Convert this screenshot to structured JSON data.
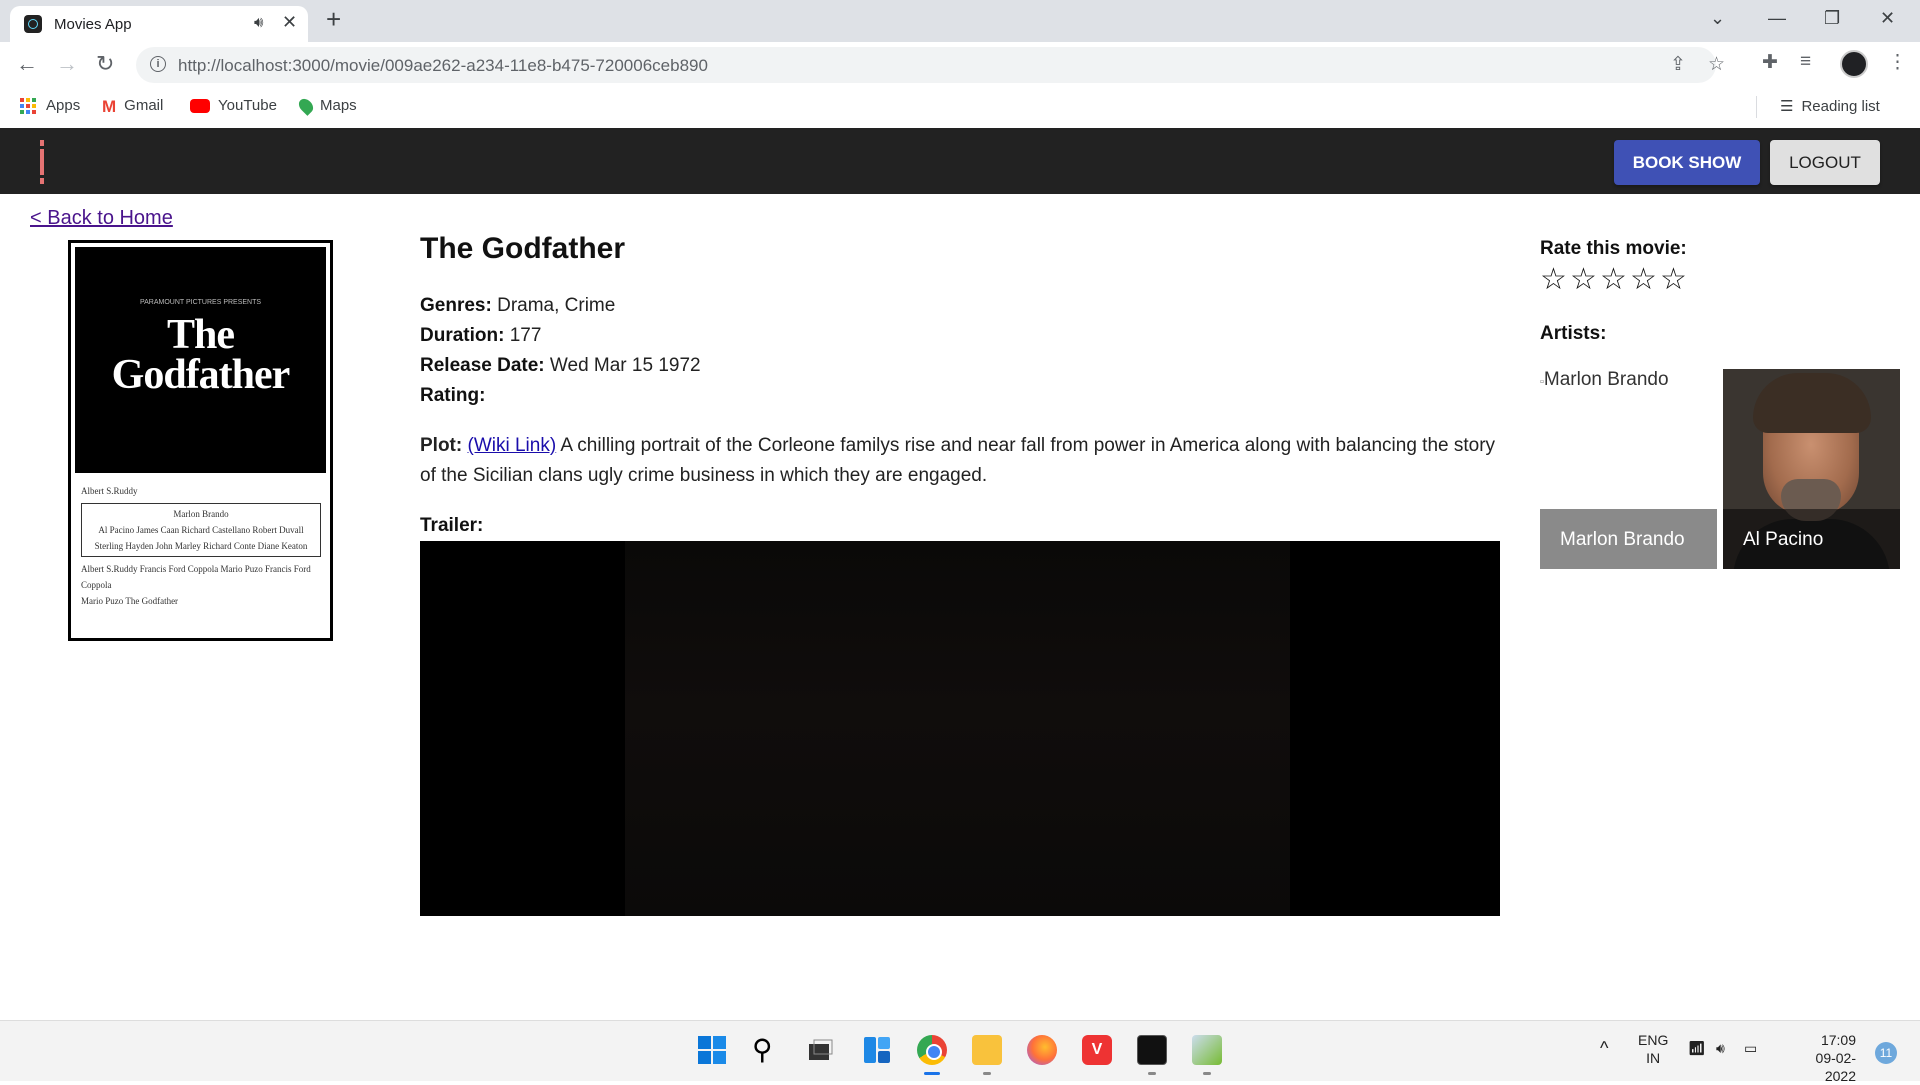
{
  "browser": {
    "tab_title": "Movies App",
    "url": "http://localhost:3000/movie/009ae262-a234-11e8-b475-720006ceb890",
    "bookmarks": [
      "Apps",
      "Gmail",
      "YouTube",
      "Maps"
    ],
    "reading_list": "Reading list"
  },
  "header": {
    "book_show": "BOOK SHOW",
    "logout": "LOGOUT"
  },
  "page": {
    "back_link": "< Back to Home",
    "poster": {
      "studio": "PARAMOUNT PICTURES PRESENTS",
      "title_line1": "The",
      "title_line2": "Godfather",
      "producer": "Albert S.Ruddy",
      "star": "Marlon Brando",
      "cast_row1": "Al Pacino   James Caan   Richard Castellano   Robert Duvall",
      "cast_row2": "Sterling Hayden   John Marley   Richard Conte   Diane Keaton",
      "credits_row1": "Albert S.Ruddy  Francis Ford Coppola  Mario Puzo  Francis Ford Coppola",
      "credits_row2": "Mario Puzo  The Godfather"
    },
    "title": "The Godfather",
    "genres_label": "Genres:",
    "genres": "Drama, Crime",
    "duration_label": "Duration:",
    "duration": "177",
    "release_label": "Release Date:",
    "release_date": "Wed Mar 15 1972",
    "rating_label": "Rating:",
    "plot_label": "Plot:",
    "wiki_link": "(Wiki Link)",
    "plot": "A chilling portrait of the Corleone familys rise and near fall from power in America along with balancing the story of the Sicilian clans ugly crime business in which they are engaged.",
    "trailer_label": "Trailer:"
  },
  "sidebar": {
    "rate_label": "Rate this movie:",
    "stars": [
      "☆",
      "☆",
      "☆",
      "☆",
      "☆"
    ],
    "artists_label": "Artists:",
    "artists": [
      {
        "name": "Marlon Brando",
        "alt": "Marlon Brando"
      },
      {
        "name": "Al Pacino"
      }
    ]
  },
  "taskbar": {
    "lang_line1": "ENG",
    "lang_line2": "IN",
    "time": "17:09",
    "date": "09-02-2022",
    "notifications": "11"
  },
  "colors": {
    "primary": "#3f51b5",
    "header_bg": "#222222",
    "link_visited": "#4a148c"
  }
}
